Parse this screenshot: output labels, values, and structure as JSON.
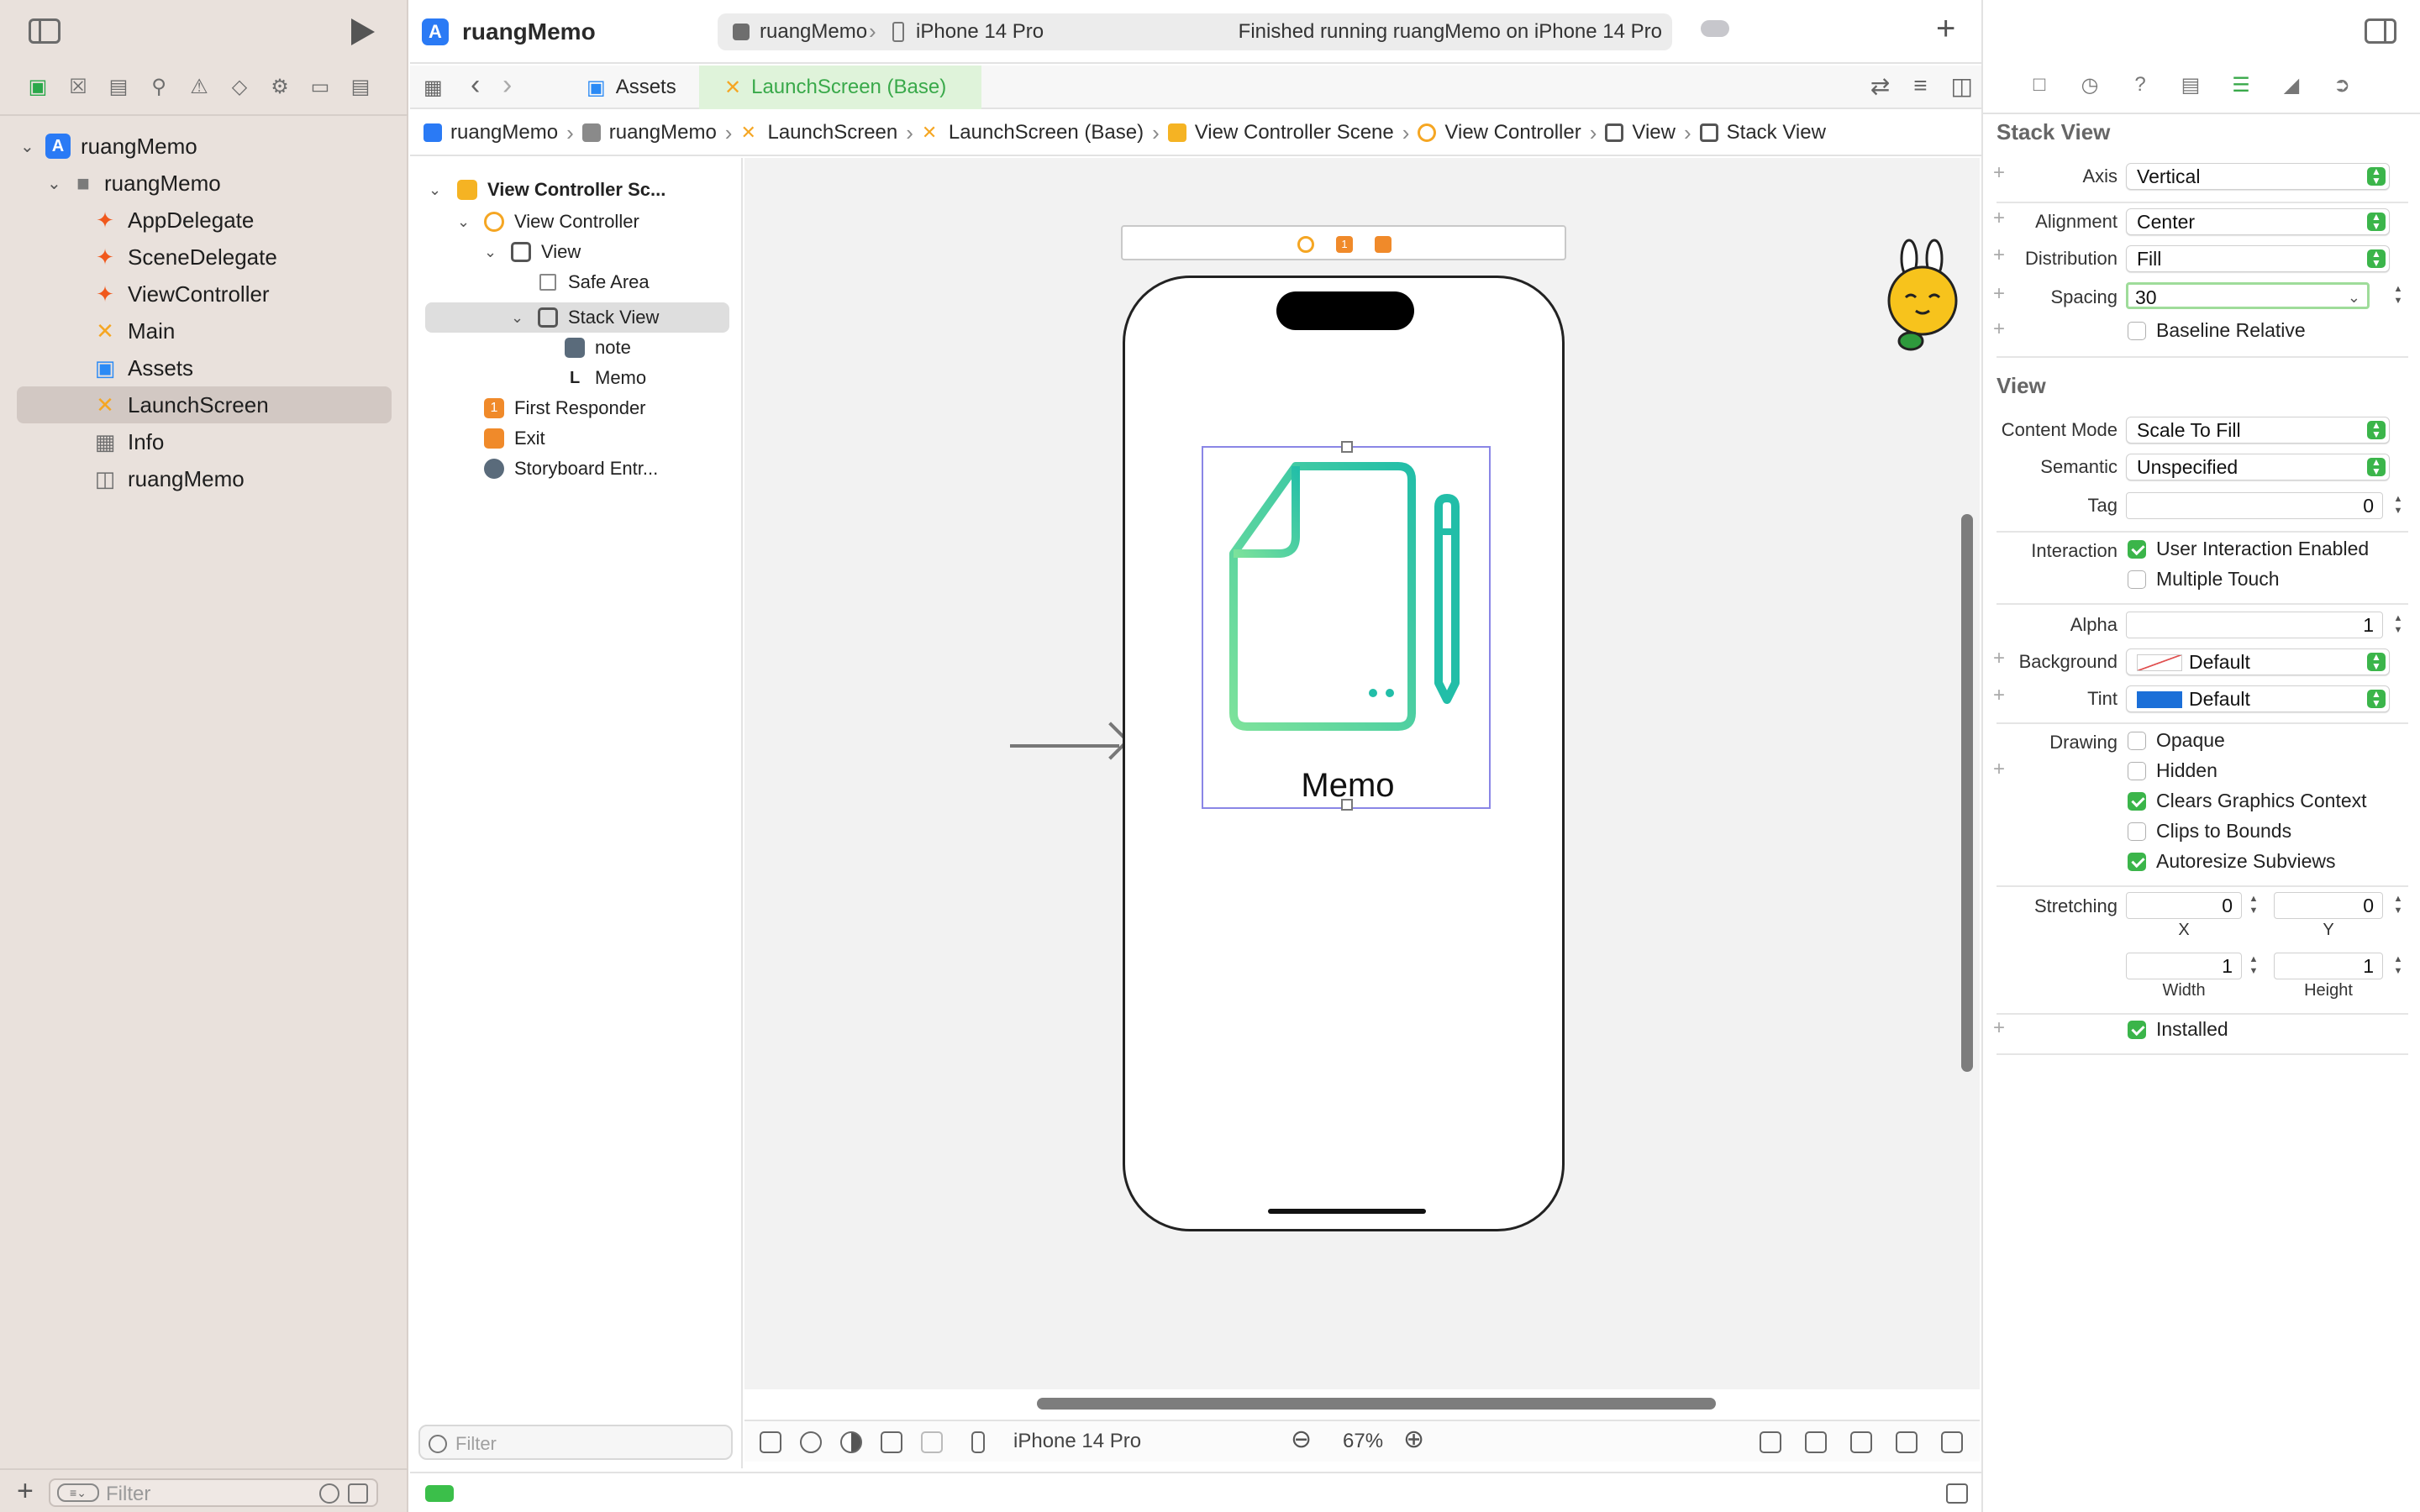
{
  "colors": {
    "accent_green": "#3bb54a",
    "navigator_bg": "#e9e1dc",
    "selection_purple": "#8a86e6",
    "tint_blue": "#1b6fd8",
    "swift_orange": "#f0581c",
    "storyboard_orange": "#f5a623"
  },
  "toolbar": {
    "project_title": "ruangMemo",
    "scheme": "ruangMemo",
    "device": "iPhone 14 Pro",
    "status": "Finished running ruangMemo on iPhone 14 Pro"
  },
  "navigator": {
    "icons": [
      "folder-icon",
      "source-control-icon",
      "symbol-icon",
      "find-icon",
      "issue-icon",
      "test-icon",
      "debug-icon",
      "breakpoint-icon",
      "report-icon"
    ],
    "tree": [
      {
        "label": "ruangMemo",
        "icon": "project-icon"
      },
      {
        "label": "ruangMemo",
        "icon": "folder-icon"
      },
      {
        "label": "AppDelegate",
        "icon": "swift-icon"
      },
      {
        "label": "SceneDelegate",
        "icon": "swift-icon"
      },
      {
        "label": "ViewController",
        "icon": "swift-icon"
      },
      {
        "label": "Main",
        "icon": "storyboard-icon"
      },
      {
        "label": "Assets",
        "icon": "assets-icon"
      },
      {
        "label": "LaunchScreen",
        "icon": "storyboard-icon"
      },
      {
        "label": "Info",
        "icon": "plist-icon"
      },
      {
        "label": "ruangMemo",
        "icon": "coredata-icon"
      }
    ],
    "filter_placeholder": "Filter"
  },
  "tabs": {
    "assets": "Assets",
    "launch": "LaunchScreen (Base)"
  },
  "jumpbar": [
    "ruangMemo",
    "ruangMemo",
    "LaunchScreen",
    "LaunchScreen (Base)",
    "View Controller Scene",
    "View Controller",
    "View",
    "Stack View"
  ],
  "outline": {
    "scene": "View Controller Sc...",
    "view_controller": "View Controller",
    "view": "View",
    "safe_area": "Safe Area",
    "stack_view": "Stack View",
    "note": "note",
    "memo": "Memo",
    "first_responder": "First Responder",
    "exit": "Exit",
    "storyboard_entry": "Storyboard Entr...",
    "filter_placeholder": "Filter"
  },
  "canvas": {
    "memo_label": "Memo",
    "first_responder_badge": "1"
  },
  "canvas_bar": {
    "device": "iPhone 14 Pro",
    "zoom": "67%"
  },
  "inspector": {
    "stack_view_title": "Stack View",
    "axis_label": "Axis",
    "axis_value": "Vertical",
    "alignment_label": "Alignment",
    "alignment_value": "Center",
    "distribution_label": "Distribution",
    "distribution_value": "Fill",
    "spacing_label": "Spacing",
    "spacing_value": "30",
    "baseline_relative": "Baseline Relative",
    "view_title": "View",
    "content_mode_label": "Content Mode",
    "content_mode_value": "Scale To Fill",
    "semantic_label": "Semantic",
    "semantic_value": "Unspecified",
    "tag_label": "Tag",
    "tag_value": "0",
    "interaction_label": "Interaction",
    "user_interaction": "User Interaction Enabled",
    "multiple_touch": "Multiple Touch",
    "alpha_label": "Alpha",
    "alpha_value": "1",
    "background_label": "Background",
    "background_value": "Default",
    "tint_label": "Tint",
    "tint_value": "Default",
    "drawing_label": "Drawing",
    "opaque": "Opaque",
    "hidden": "Hidden",
    "clears_graphics": "Clears Graphics Context",
    "clips_bounds": "Clips to Bounds",
    "autoresize": "Autoresize Subviews",
    "stretching_label": "Stretching",
    "stretch_x": "0",
    "stretch_y": "0",
    "x_label": "X",
    "y_label": "Y",
    "stretch_w": "1",
    "stretch_h": "1",
    "width_label": "Width",
    "height_label": "Height",
    "installed": "Installed"
  }
}
